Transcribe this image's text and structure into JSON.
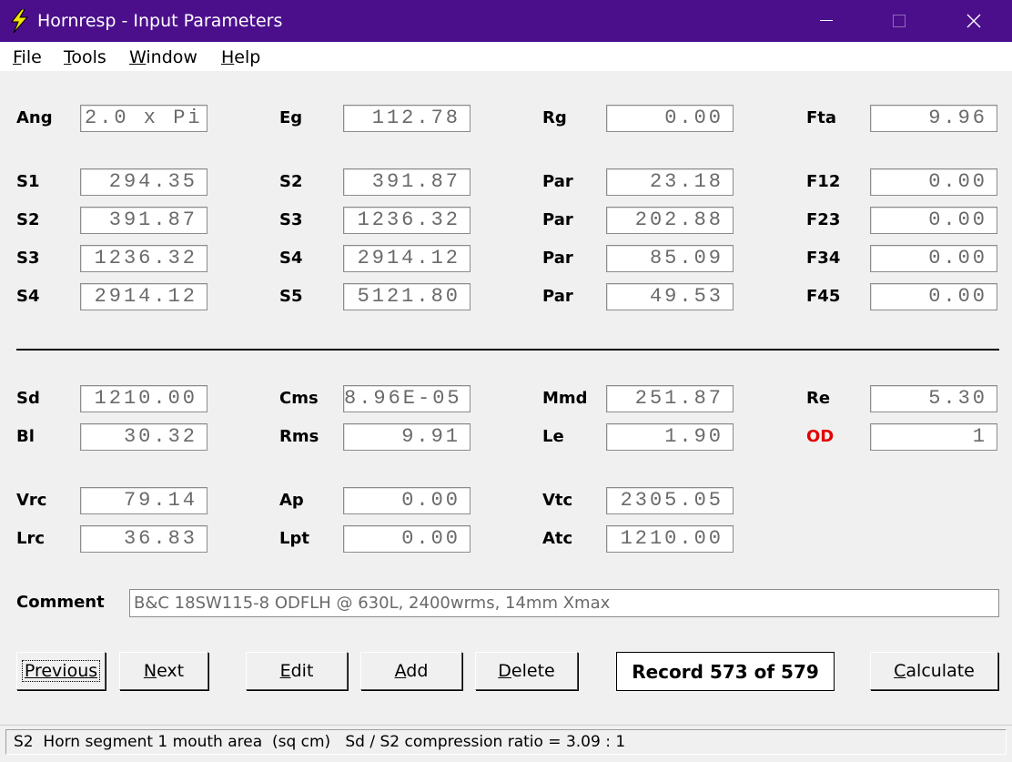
{
  "window": {
    "title": "Hornresp - Input Parameters"
  },
  "menu": [
    {
      "key": "F",
      "rest": "ile"
    },
    {
      "key": "T",
      "rest": "ools"
    },
    {
      "key": "W",
      "rest": "indow"
    },
    {
      "key": "H",
      "rest": "elp"
    }
  ],
  "labels": {
    "ang": "Ang",
    "eg": "Eg",
    "rg": "Rg",
    "fta": "Fta",
    "r1c1": "S1",
    "r1c2": "S2",
    "r1c3": "Par",
    "r1c4": "F12",
    "r2c1": "S2",
    "r2c2": "S3",
    "r2c3": "Par",
    "r2c4": "F23",
    "r3c1": "S3",
    "r3c2": "S4",
    "r3c3": "Par",
    "r3c4": "F34",
    "r4c1": "S4",
    "r4c2": "S5",
    "r4c3": "Par",
    "r4c4": "F45",
    "sd": "Sd",
    "cms": "Cms",
    "mmd": "Mmd",
    "re": "Re",
    "bl": "Bl",
    "rms": "Rms",
    "le": "Le",
    "od": "OD",
    "vrc": "Vrc",
    "ap": "Ap",
    "vtc": "Vtc",
    "lrc": "Lrc",
    "lpt": "Lpt",
    "atc": "Atc",
    "comment": "Comment"
  },
  "values": {
    "ang": "2.0 x Pi",
    "eg": "112.78",
    "rg": "0.00",
    "fta": "9.96",
    "r1c1": "294.35",
    "r1c2": "391.87",
    "r1c3": "23.18",
    "r1c4": "0.00",
    "r2c1": "391.87",
    "r2c2": "1236.32",
    "r2c3": "202.88",
    "r2c4": "0.00",
    "r3c1": "1236.32",
    "r3c2": "2914.12",
    "r3c3": "85.09",
    "r3c4": "0.00",
    "r4c1": "2914.12",
    "r4c2": "5121.80",
    "r4c3": "49.53",
    "r4c4": "0.00",
    "sd": "1210.00",
    "cms": "8.96E-05",
    "mmd": "251.87",
    "re": "5.30",
    "bl": "30.32",
    "rms": "9.91",
    "le": "1.90",
    "od": "1",
    "vrc": "79.14",
    "ap": "0.00",
    "vtc": "2305.05",
    "lrc": "36.83",
    "lpt": "0.00",
    "atc": "1210.00"
  },
  "comment": "B&C 18SW115-8 ODFLH @ 630L, 2400wrms, 14mm Xmax",
  "buttons": {
    "previous": {
      "key": "P",
      "rest": "revious"
    },
    "next": {
      "key": "N",
      "rest": "ext"
    },
    "edit": {
      "key": "E",
      "rest": "dit"
    },
    "add": {
      "key": "A",
      "rest": "dd"
    },
    "delete": {
      "key": "D",
      "rest": "elete"
    },
    "calculate": {
      "key": "C",
      "rest": "alculate"
    }
  },
  "record": "Record 573 of 579",
  "status": "S2  Horn segment 1 mouth area  (sq cm)   Sd / S2 compression ratio = 3.09 : 1",
  "colors": {
    "titlebar": "#4b0f8c",
    "od_label": "#e00000",
    "icon": "#f4e400"
  }
}
